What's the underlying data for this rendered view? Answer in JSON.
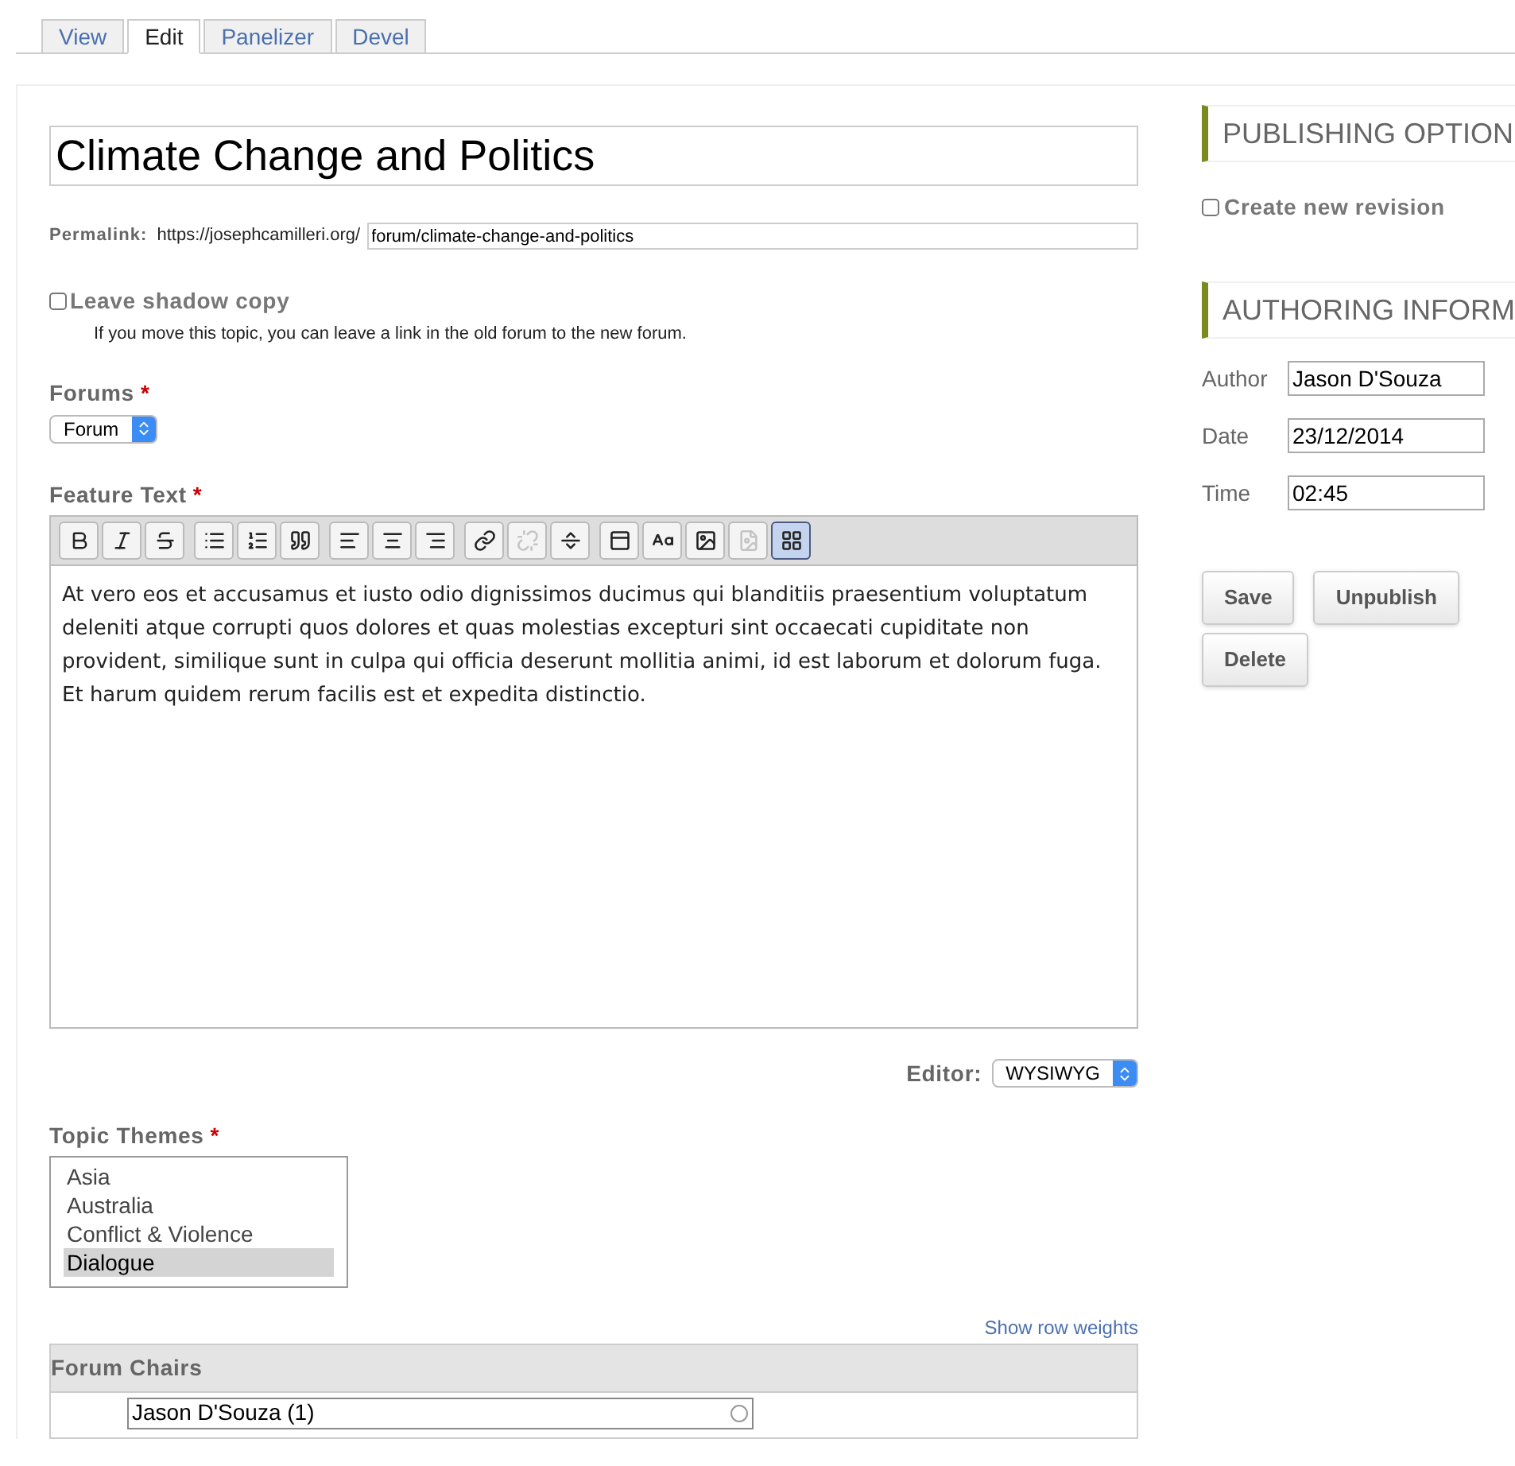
{
  "tabs": [
    {
      "label": "View",
      "selected": false
    },
    {
      "label": "Edit",
      "selected": true
    },
    {
      "label": "Panelizer",
      "selected": false
    },
    {
      "label": "Devel",
      "selected": false
    }
  ],
  "title_field": {
    "value": "Climate Change and Politics"
  },
  "permalink": {
    "label": "Permalink:",
    "base": "https://josephcamilleri.org/",
    "value": "forum/climate-change-and-politics"
  },
  "shadow_copy": {
    "label": "Leave shadow copy",
    "checked": false,
    "description": "If you move this topic, you can leave a link in the old forum to the new forum."
  },
  "forums": {
    "label": "Forums",
    "required": "*",
    "value": "Forum"
  },
  "feature_text": {
    "label": "Feature Text",
    "required": "*",
    "toolbar": [
      [
        {
          "kind": "bold",
          "disabled": false,
          "selected": false
        },
        {
          "kind": "italic",
          "disabled": false,
          "selected": false
        },
        {
          "kind": "strike",
          "disabled": false,
          "selected": false
        }
      ],
      [
        {
          "kind": "bullets",
          "disabled": false,
          "selected": false
        },
        {
          "kind": "numbers",
          "disabled": false,
          "selected": false
        },
        {
          "kind": "quote",
          "disabled": false,
          "selected": false
        }
      ],
      [
        {
          "kind": "align-left",
          "disabled": false,
          "selected": false
        },
        {
          "kind": "align-center",
          "disabled": false,
          "selected": false
        },
        {
          "kind": "align-right",
          "disabled": false,
          "selected": false
        }
      ],
      [
        {
          "kind": "link",
          "disabled": false,
          "selected": false
        },
        {
          "kind": "unlink",
          "disabled": true,
          "selected": false
        },
        {
          "kind": "break",
          "disabled": false,
          "selected": false
        }
      ],
      [
        {
          "kind": "template",
          "disabled": false,
          "selected": false
        },
        {
          "kind": "spell",
          "disabled": false,
          "selected": false
        },
        {
          "kind": "image",
          "disabled": false,
          "selected": false
        },
        {
          "kind": "page",
          "disabled": true,
          "selected": false
        },
        {
          "kind": "blocks",
          "disabled": false,
          "selected": true
        }
      ]
    ],
    "body": "At vero eos et accusamus et iusto odio dignissimos ducimus qui blanditiis praesentium voluptatum deleniti atque corrupti quos dolores et quas molestias excepturi sint occaecati cupiditate non provident, similique sunt in culpa qui officia deserunt mollitia animi, id est laborum et dolorum fuga. Et harum quidem rerum facilis est et expedita distinctio.",
    "editor_label": "Editor:",
    "editor_value": "WYSIWYG"
  },
  "topic_themes": {
    "label": "Topic Themes",
    "required": "*",
    "options": [
      {
        "label": "Asia",
        "selected": false
      },
      {
        "label": "Australia",
        "selected": false
      },
      {
        "label": "Conflict & Violence",
        "selected": false
      },
      {
        "label": "Dialogue",
        "selected": true
      }
    ]
  },
  "show_row_weights": "Show row weights",
  "forum_chairs": {
    "header": "Forum Chairs",
    "rows": [
      {
        "value": "Jason D'Souza (1)"
      }
    ]
  },
  "publishing": {
    "heading": "PUBLISHING OPTION",
    "revision": {
      "label": "Create new revision",
      "checked": false
    }
  },
  "authoring": {
    "heading": "AUTHORING INFORM",
    "fields": [
      {
        "label": "Author",
        "value": "Jason D'Souza"
      },
      {
        "label": "Date",
        "value": "23/12/2014"
      },
      {
        "label": "Time",
        "value": "02:45"
      }
    ]
  },
  "actions": [
    "Save",
    "Unpublish",
    "Delete"
  ]
}
